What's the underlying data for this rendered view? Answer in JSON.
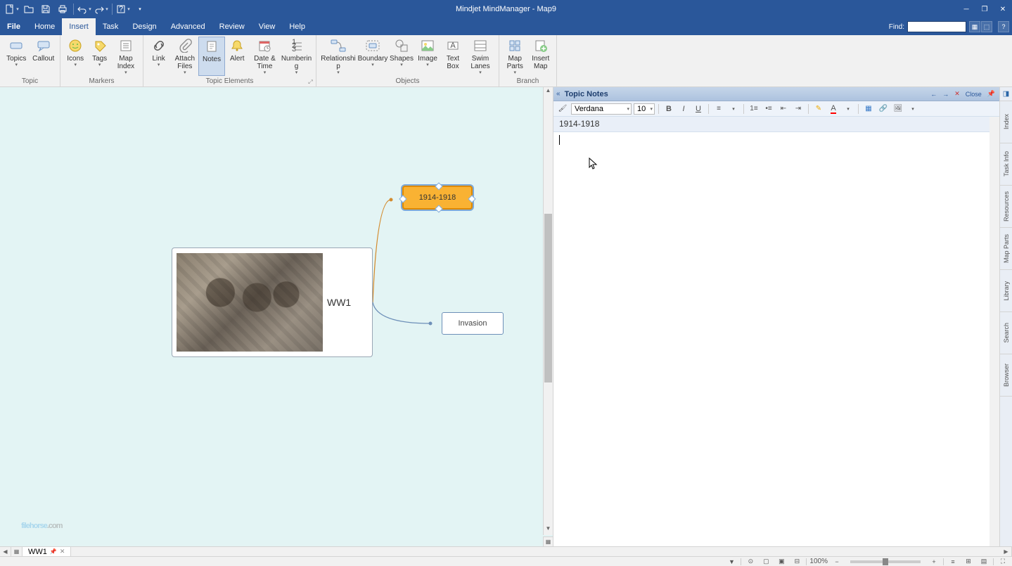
{
  "app": {
    "title": "Mindjet MindManager - Map9"
  },
  "menu": {
    "file": "File",
    "home": "Home",
    "insert": "Insert",
    "task": "Task",
    "design": "Design",
    "advanced": "Advanced",
    "review": "Review",
    "view": "View",
    "help": "Help",
    "find_label": "Find:"
  },
  "ribbon": {
    "groups": {
      "topic": "Topic",
      "markers": "Markers",
      "topic_elements": "Topic Elements",
      "objects": "Objects",
      "branch": "Branch"
    },
    "btns": {
      "topics": "Topics",
      "callout": "Callout",
      "icons": "Icons",
      "tags": "Tags",
      "map_index": "Map Index",
      "link": "Link",
      "attach": "Attach Files",
      "notes": "Notes",
      "alert": "Alert",
      "datetime": "Date & Time",
      "numbering": "Numbering",
      "relationship": "Relationship",
      "boundary": "Boundary",
      "shapes": "Shapes",
      "image": "Image",
      "textbox": "Text Box",
      "swimlanes": "Swim Lanes",
      "mapparts": "Map Parts",
      "insertmap": "Insert Map"
    }
  },
  "mindmap": {
    "main_topic": "WW1",
    "selected_topic": "1914-1918",
    "sub_topic": "Invasion"
  },
  "notes": {
    "panel_title": "Topic Notes",
    "close": "Close",
    "font": "Verdana",
    "size": "10",
    "note_title": "1914-1918",
    "body": ""
  },
  "side_tabs": [
    "Index",
    "Task Info",
    "Resources",
    "Map Parts",
    "Library",
    "Search",
    "Browser"
  ],
  "bottom_tab": {
    "name": "WW1"
  },
  "status": {
    "zoom": "100%"
  },
  "watermark": {
    "p1": "filehorse",
    "p2": ".com"
  }
}
